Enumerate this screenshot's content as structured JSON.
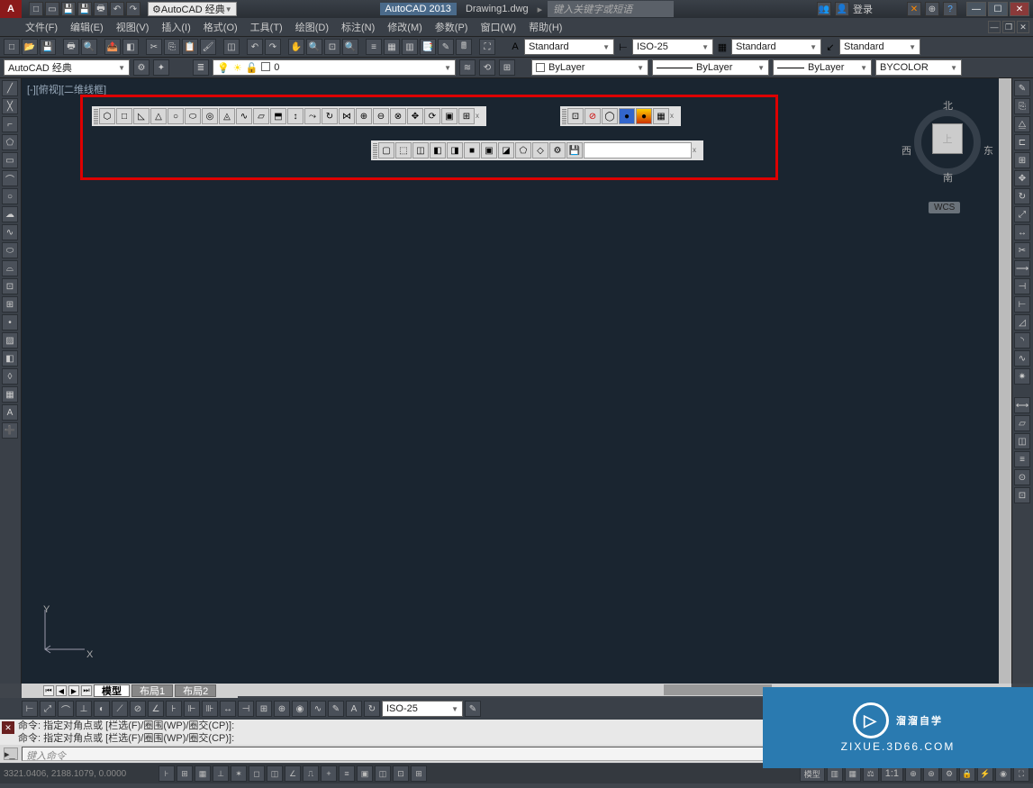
{
  "title": {
    "app": "AutoCAD 2013",
    "doc": "Drawing1.dwg",
    "search_placeholder": "键入关键字或短语",
    "login": "登录"
  },
  "workspace_dd": "AutoCAD 经典",
  "menus": [
    "文件(F)",
    "编辑(E)",
    "视图(V)",
    "插入(I)",
    "格式(O)",
    "工具(T)",
    "绘图(D)",
    "标注(N)",
    "修改(M)",
    "参数(P)",
    "窗口(W)",
    "帮助(H)"
  ],
  "style_toolbar": {
    "text": "Standard",
    "dim": "ISO-25",
    "table": "Standard",
    "ml": "Standard"
  },
  "workspace_row": {
    "ws": "AutoCAD 经典",
    "layer": "0"
  },
  "props": {
    "color": "ByLayer",
    "ltype": "ByLayer",
    "lweight": "ByLayer",
    "plot": "BYCOLOR"
  },
  "viewport_label": "[-][俯视][二维线框]",
  "viewcube": {
    "n": "北",
    "s": "南",
    "e": "东",
    "w": "西",
    "top": "上",
    "wcs": "WCS"
  },
  "ucs": {
    "x": "X",
    "y": "Y"
  },
  "tabs": {
    "model": "模型",
    "layout1": "布局1",
    "layout2": "布局2"
  },
  "dim_dd": "ISO-25",
  "command": {
    "history1": "命令: 指定对角点或 [栏选(F)/圈围(WP)/圈交(CP)]:",
    "history2": "命令: 指定对角点或 [栏选(F)/圈围(WP)/圈交(CP)]:",
    "placeholder": "键入命令"
  },
  "status": {
    "coords": "3321.0406, 2188.1079, 0.0000",
    "model": "模型",
    "scale": "1:1"
  },
  "watermark": {
    "title": "溜溜自学",
    "sub": "ZIXUE.3D66.COM"
  }
}
